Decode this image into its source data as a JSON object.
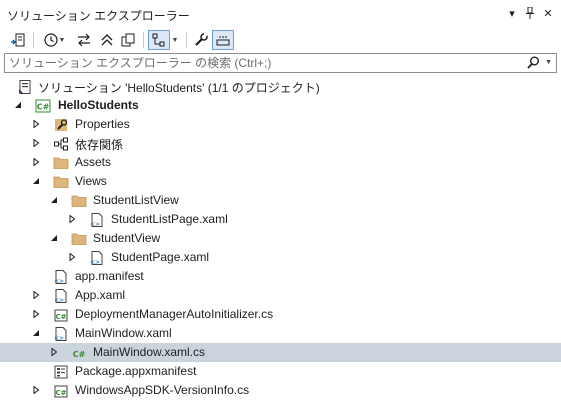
{
  "window": {
    "title": "ソリューション エクスプローラー",
    "controls": {
      "dropdown": "▾",
      "pin": "⊥",
      "close": "✕"
    }
  },
  "search": {
    "placeholder": "ソリューション エクスプローラー の検索 (Ctrl+;)",
    "value": ""
  },
  "tree": {
    "solution": {
      "label": "ソリューション 'HelloStudents' (1/1 のプロジェクト)"
    },
    "project": {
      "label": "HelloStudents"
    },
    "items": [
      {
        "label": "Properties"
      },
      {
        "label": "依存関係"
      },
      {
        "label": "Assets"
      },
      {
        "label": "Views"
      },
      {
        "label": "StudentListView"
      },
      {
        "label": "StudentListPage.xaml"
      },
      {
        "label": "StudentView"
      },
      {
        "label": "StudentPage.xaml"
      },
      {
        "label": "app.manifest"
      },
      {
        "label": "App.xaml"
      },
      {
        "label": "DeploymentManagerAutoInitializer.cs"
      },
      {
        "label": "MainWindow.xaml"
      },
      {
        "label": "MainWindow.xaml.cs"
      },
      {
        "label": "Package.appxmanifest"
      },
      {
        "label": "WindowsAppSDK-VersionInfo.cs"
      }
    ]
  },
  "colors": {
    "selection": "#cbd3dd",
    "folder": "#dcb67a",
    "csharp": "#388a34",
    "accent": "#005a9e"
  }
}
